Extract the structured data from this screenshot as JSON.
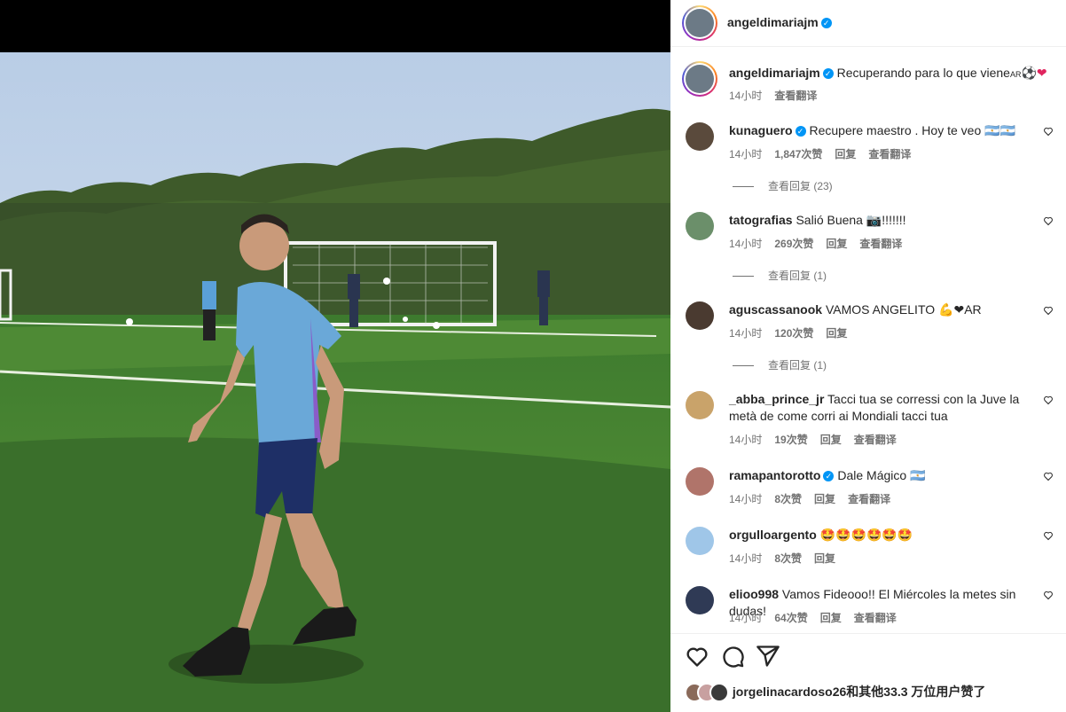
{
  "post": {
    "author": "angeldimariajm",
    "verified_mark": "✓",
    "caption": "Recuperando para lo que viene",
    "caption_flag": "AR",
    "caption_emojis": "⚽❤",
    "caption_time": "14小时",
    "translate": "查看翻译"
  },
  "comments": [
    {
      "user": "kunaguero",
      "verified": true,
      "text": "Recupere maestro . Hoy te veo 🇦🇷🇦🇷",
      "time": "14小时",
      "likes": "1,847次赞",
      "reply": "回复",
      "translate": "查看翻译",
      "replies": "查看回复 (23)",
      "avatar_color": "#5a4a3c"
    },
    {
      "user": "tatografias",
      "verified": false,
      "text": "Salió Buena 📷!!!!!!!",
      "time": "14小时",
      "likes": "269次赞",
      "reply": "回复",
      "translate": "查看翻译",
      "replies": "查看回复 (1)",
      "avatar_color": "#6b8f6a"
    },
    {
      "user": "aguscassanook",
      "verified": false,
      "text": "VAMOS ANGELITO 💪❤AR",
      "time": "14小时",
      "likes": "120次赞",
      "reply": "回复",
      "translate": "",
      "replies": "查看回复 (1)",
      "avatar_color": "#4a3a30"
    },
    {
      "user": "_abba_prince_jr",
      "verified": false,
      "text": "Tacci tua se corressi con la Juve la metà de come corri ai Mondiali tacci tua",
      "time": "14小时",
      "likes": "19次赞",
      "reply": "回复",
      "translate": "查看翻译",
      "replies": "",
      "avatar_color": "#c9a36a"
    },
    {
      "user": "ramapantorotto",
      "verified": true,
      "text": "Dale Mágico 🇦🇷",
      "time": "14小时",
      "likes": "8次赞",
      "reply": "回复",
      "translate": "查看翻译",
      "replies": "",
      "avatar_color": "#b0746a"
    },
    {
      "user": "orgulloargento",
      "verified": false,
      "text": "🤩🤩🤩🤩🤩🤩",
      "time": "14小时",
      "likes": "8次赞",
      "reply": "回复",
      "translate": "",
      "replies": "",
      "avatar_color": "#9fc6e8"
    },
    {
      "user": "elioo998",
      "verified": false,
      "text": "Vamos Fideooo!! El Miércoles la metes sin dudas!",
      "time": "14小时",
      "likes": "64次赞",
      "reply": "回复",
      "translate": "查看翻译",
      "replies": "",
      "avatar_color": "#2f3a55"
    }
  ],
  "likes_line": {
    "user": "jorgelinacardoso26",
    "rest": "和其他33.3 万位用户赞了"
  }
}
